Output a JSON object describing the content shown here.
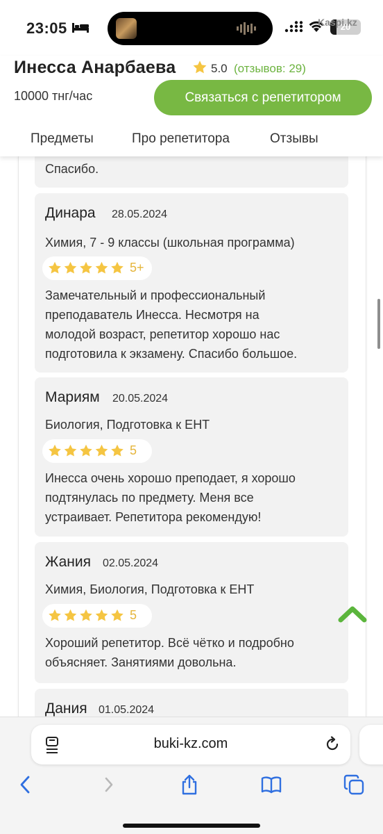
{
  "status_bar": {
    "time": "23:05",
    "battery": "20",
    "battery_level_percent": 20,
    "watermark": "Kaspi.kz",
    "icons": [
      "bed-icon",
      "signal-icon",
      "wifi-icon",
      "battery-icon"
    ]
  },
  "header": {
    "tutor_name": "Инесса Анарбаева",
    "rating": "5.0",
    "reviews_count": "(отзывов: 29)",
    "price": "10000 тнг/час",
    "contact_button": "Связаться с репетитором",
    "accent_color": "#78b843",
    "star_color": "#f5c542"
  },
  "tabs": [
    {
      "label": "Предметы"
    },
    {
      "label": "Про репетитора"
    },
    {
      "label": "Отзывы"
    }
  ],
  "reviews": {
    "partial_text": "Спасибо.",
    "items": [
      {
        "name": "Динара",
        "date": "28.05.2024",
        "subject": "Химия, 7 - 9 классы (школьная программа)",
        "stars": 5,
        "score_label": "5+",
        "text_lines": [
          "Замечательный и профессиональный",
          "преподаватель Инесса. Несмотря на",
          "молодой возраст, репетитор хорошо нас",
          "подготовила к экзамену. Спасибо большое."
        ]
      },
      {
        "name": "Мариям",
        "date": "20.05.2024",
        "subject": "Биология, Подготовка к ЕНТ",
        "stars": 5,
        "score_label": "5",
        "text_lines": [
          "Инесса очень хорошо преподает, я хорошо",
          "подтянулась по предмету. Меня все",
          "устраивает. Репетитора рекомендую!"
        ]
      },
      {
        "name": "Жания",
        "date": "02.05.2024",
        "subject": "Химия, Биология, Подготовка к ЕНТ",
        "stars": 5,
        "score_label": "5",
        "text_lines": [
          "Хороший репетитор. Всё чётко и подробно",
          "объясняет. Занятиями довольна."
        ]
      },
      {
        "name": "Дания",
        "date": "01.05.2024"
      }
    ]
  },
  "browser": {
    "url": "buki-kz.com",
    "nav_icons": [
      "back-icon",
      "forward-icon",
      "share-icon",
      "bookmarks-icon",
      "tabs-icon"
    ]
  }
}
